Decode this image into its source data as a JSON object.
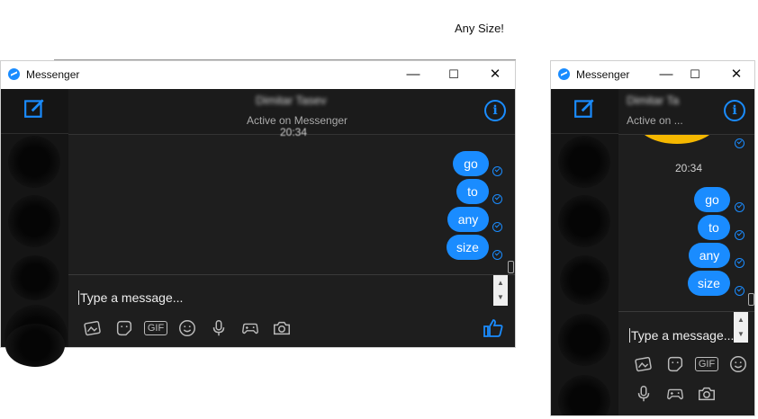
{
  "caption": "Any Size!",
  "windows": [
    {
      "title": "Messenger",
      "controls": [
        "—",
        "☐",
        "✕"
      ],
      "header": {
        "name": "Dimitar Tasev",
        "status": "Active on Messenger"
      },
      "timestamp": "20:34",
      "messages": [
        "go",
        "to",
        "any",
        "size"
      ],
      "input_placeholder": "Type a message...",
      "gif_label": "GIF"
    },
    {
      "title": "Messenger",
      "controls": [
        "—",
        "☐",
        "✕"
      ],
      "header": {
        "name": "Dimitar Ta",
        "status": "Active on ..."
      },
      "timestamp": "20:34",
      "messages": [
        "go",
        "to",
        "any",
        "size"
      ],
      "input_placeholder": "Type a message...",
      "gif_label": "GIF"
    }
  ],
  "colors": {
    "accent": "#1a8cff",
    "dark_bg": "#1e1e1e",
    "sidebar_bg": "#151515",
    "emoji_yellow": "#f5b800"
  },
  "icons": [
    "messenger-logo-icon",
    "compose-icon",
    "info-icon",
    "sent-check-icon",
    "photos-icon",
    "sticker-icon",
    "gif-icon",
    "emoji-icon",
    "microphone-icon",
    "game-controller-icon",
    "camera-icon",
    "thumbs-up-icon"
  ]
}
